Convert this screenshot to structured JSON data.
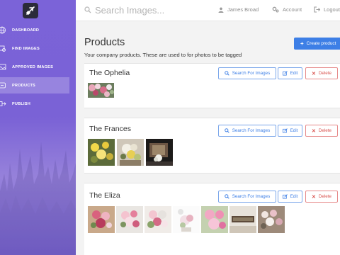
{
  "search": {
    "placeholder": "Search Images..."
  },
  "user": {
    "name": "James Broad"
  },
  "topnav": {
    "account": "Account",
    "logout": "Logout"
  },
  "sidebar": {
    "items": [
      {
        "label": "DASHBOARD",
        "icon": "globe-icon",
        "active": false
      },
      {
        "label": "FIND IMAGES",
        "icon": "image-search-icon",
        "active": false
      },
      {
        "label": "APPROVED IMAGES",
        "icon": "images-icon",
        "active": false
      },
      {
        "label": "PRODUCTS",
        "icon": "tag-icon",
        "active": true
      },
      {
        "label": "PUBLISH",
        "icon": "share-icon",
        "active": false
      }
    ]
  },
  "page": {
    "title": "Products",
    "subtitle": "Your company products. These are used to for photos to be tagged",
    "create_label": "Create product"
  },
  "actions": {
    "search_label": "Search For Images",
    "edit_label": "Edit",
    "delete_label": "Delete"
  },
  "products": [
    {
      "name": "The Ophelia",
      "thumbs": 1
    },
    {
      "name": "The Frances",
      "thumbs": 3
    },
    {
      "name": "The Eliza",
      "thumbs": 7
    }
  ],
  "colors": {
    "accent": "#3d7fe6",
    "danger": "#d9534f",
    "sidebar": "#7b63d8"
  }
}
